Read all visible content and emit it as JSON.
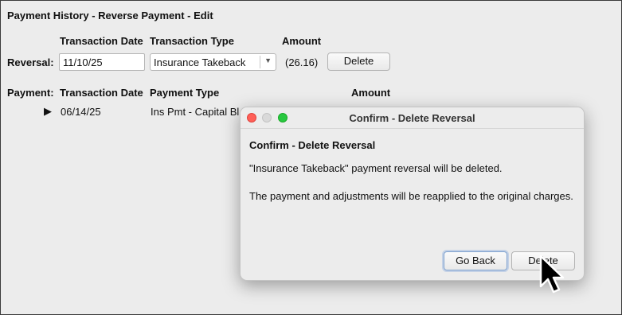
{
  "window": {
    "title": "Payment History - Reverse Payment - Edit"
  },
  "reversal": {
    "row_label": "Reversal:",
    "headers": {
      "transaction_date": "Transaction Date",
      "transaction_type": "Transaction Type",
      "amount": "Amount"
    },
    "transaction_date": "11/10/25",
    "transaction_type": "Insurance Takeback",
    "amount": "(26.16)",
    "delete_label": "Delete"
  },
  "payment": {
    "row_label": "Payment:",
    "headers": {
      "transaction_date": "Transaction Date",
      "payment_type": "Payment Type",
      "amount": "Amount"
    },
    "expand_glyph": "▶",
    "transaction_date": "06/14/25",
    "payment_type": "Ins Pmt - Capital Bl"
  },
  "dialog": {
    "title": "Confirm - Delete Reversal",
    "heading": "Confirm - Delete Reversal",
    "message_line1": "\"Insurance Takeback\" payment reversal will be deleted.",
    "message_line2": "The payment and adjustments will be reapplied to the original charges.",
    "go_back_label": "Go Back",
    "delete_label": "Delete"
  },
  "colors": {
    "close": "#ff5f57",
    "minimize_disabled": "#d9d9d9",
    "zoom": "#28c840",
    "default_button_focus": "#7fa2cf"
  },
  "icons": {
    "dropdown": "chevron-down-icon",
    "expand": "disclosure-triangle-icon",
    "pointer": "mouse-pointer-icon"
  }
}
